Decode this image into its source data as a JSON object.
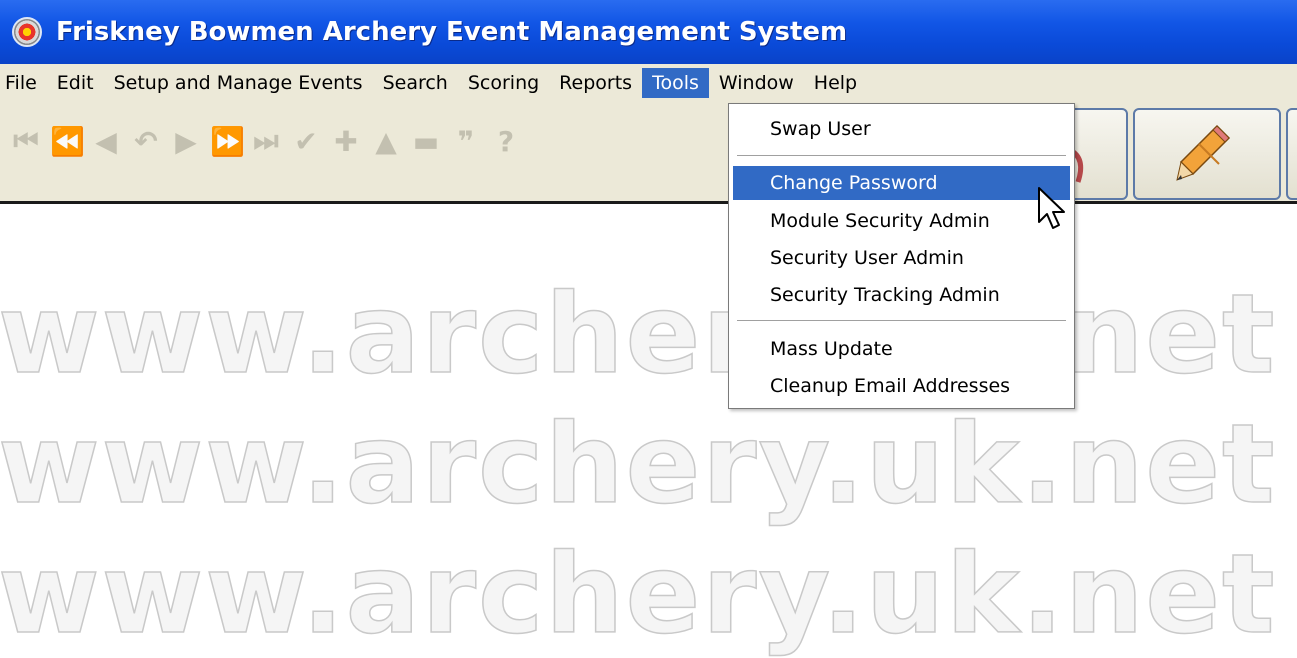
{
  "window": {
    "title": "Friskney Bowmen Archery Event Management System",
    "title_bar_color": "#0a4ad8"
  },
  "menubar": {
    "items": [
      "File",
      "Edit",
      "Setup and Manage Events",
      "Search",
      "Scoring",
      "Reports",
      "Tools",
      "Window",
      "Help"
    ],
    "active": "Tools"
  },
  "toolbar": {
    "nav_icons": [
      "first-record-icon",
      "rewind-icon",
      "previous-icon",
      "undo-icon",
      "next-icon",
      "fast-forward-icon",
      "last-record-icon",
      "save-check-icon",
      "add-icon",
      "up-icon",
      "delete-icon",
      "quote-icon",
      "help-icon"
    ],
    "nav_glyphs": [
      "⏮",
      "⏪",
      "◀",
      "↶",
      "▶",
      "⏩",
      "⏭",
      "✔",
      "✚",
      "▲",
      "▬",
      "❞",
      "?"
    ]
  },
  "tools_menu": {
    "items": [
      {
        "label": "Swap User"
      },
      {
        "label": "Change Password",
        "highlighted": true
      },
      {
        "label": "Module Security Admin"
      },
      {
        "label": "Security User Admin"
      },
      {
        "label": "Security Tracking Admin"
      },
      {
        "label": "Mass Update"
      },
      {
        "label": "Cleanup Email Addresses"
      }
    ],
    "highlight_color": "#316ac5"
  },
  "watermark": {
    "lines": [
      "www.archery.uk.net www.arch",
      "www.archery.uk.net www.arch",
      "www.archery.uk.net www.arch"
    ]
  }
}
